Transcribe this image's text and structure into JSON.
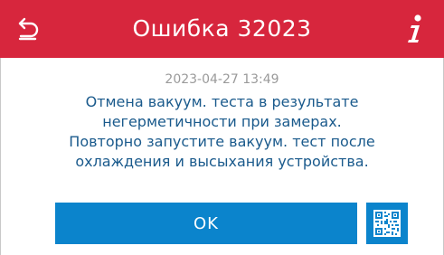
{
  "colors": {
    "header_bg": "#d7263d",
    "primary": "#0b84cc",
    "message_text": "#1a5a8c",
    "timestamp_text": "#9a9a9a"
  },
  "header": {
    "title": "Ошибка 32023",
    "back_icon": "back-arrow-icon",
    "info_icon": "info-icon"
  },
  "dialog": {
    "timestamp": "2023-04-27 13:49",
    "message_lines": [
      "Отмена вакуум. теста в результате",
      "негерметичности при замерах.",
      "Повторно запустите вакуум. тест после",
      "охлаждения и высыхания устройства."
    ]
  },
  "actions": {
    "ok_label": "OK",
    "qr_icon": "qr-code-icon"
  }
}
